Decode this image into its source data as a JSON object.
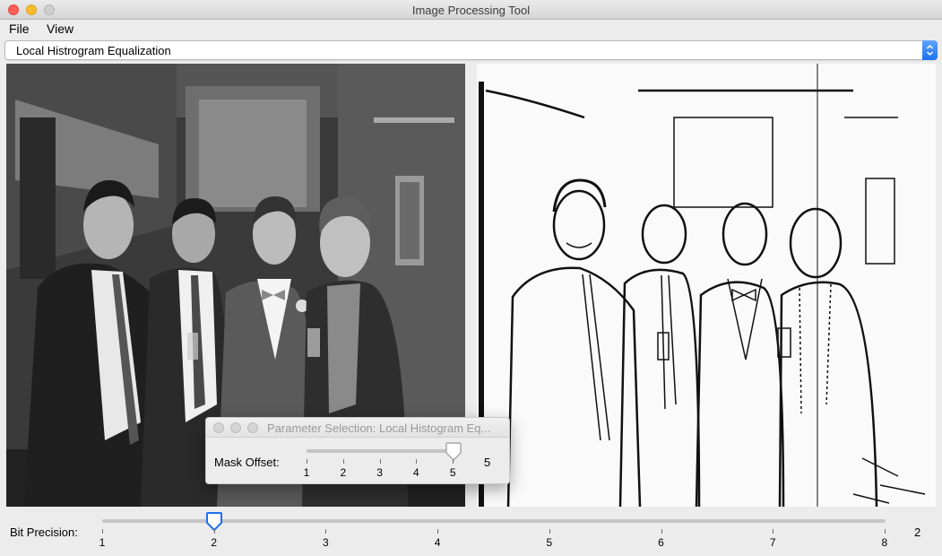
{
  "window": {
    "title": "Image Processing Tool"
  },
  "menu": {
    "file": "File",
    "view": "View"
  },
  "filter_select": {
    "selected": "Local Histrogram Equalization"
  },
  "images": {
    "original": "grayscale-photo",
    "processed": "equalized-photo"
  },
  "bit_precision": {
    "label": "Bit Precision:",
    "ticks": [
      "1",
      "2",
      "3",
      "4",
      "5",
      "6",
      "7",
      "8"
    ],
    "value": 2,
    "value_display": "2"
  },
  "dialog": {
    "title": "Parameter Selection: Local Histogram Eq...",
    "mask_offset": {
      "label": "Mask Offset:",
      "ticks": [
        "1",
        "2",
        "3",
        "4",
        "5"
      ],
      "value": 5,
      "value_display": "5"
    }
  },
  "colors": {
    "accent": "#1d6ff2",
    "close": "#fc5f57",
    "minimize": "#fdbc2e"
  }
}
